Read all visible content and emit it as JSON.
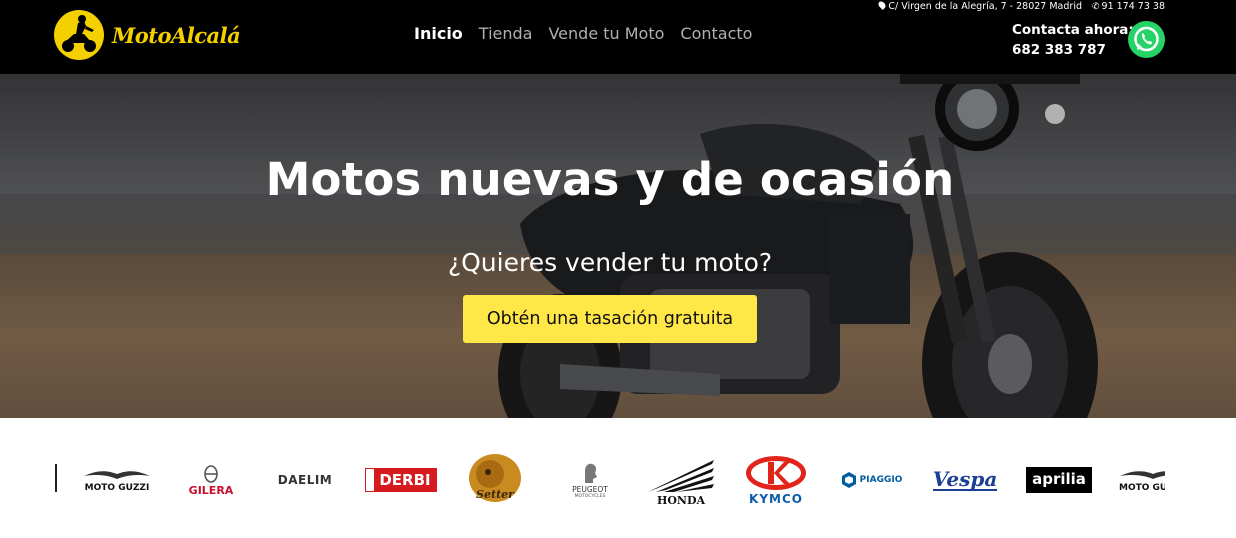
{
  "header": {
    "logo_text": "MotoAlcalá",
    "nav": [
      {
        "label": "Inicio",
        "active": true
      },
      {
        "label": "Tienda",
        "active": false
      },
      {
        "label": "Vende tu Moto",
        "active": false
      },
      {
        "label": "Contacto",
        "active": false
      }
    ],
    "address": "C/ Virgen de la Alegría, 7 - 28027 Madrid",
    "landline": "91 174 73 38",
    "contact_label": "Contacta ahora:",
    "contact_phone": "682 383 787",
    "icons": {
      "address": "map-pin-icon",
      "landline": "phone-icon",
      "whatsapp": "whatsapp-icon"
    }
  },
  "hero": {
    "title": "Motos nuevas y de ocasión",
    "subtitle": "¿Quieres vender tu moto?",
    "cta_label": "Obtén una tasación gratuita",
    "colors": {
      "cta": "#ffe747",
      "brand_yellow": "#f5d000"
    }
  },
  "brands": [
    {
      "name": "MOTO GUZZI"
    },
    {
      "name": "GILERA"
    },
    {
      "name": "DAELIM"
    },
    {
      "name": "DERBI"
    },
    {
      "name": "Setter"
    },
    {
      "name": "PEUGEOT",
      "sub": "MOTOCYCLES"
    },
    {
      "name": "HONDA"
    },
    {
      "name": "KYMCO"
    },
    {
      "name": "PIAGGIO"
    },
    {
      "name": "Vespa"
    },
    {
      "name": "aprilia"
    },
    {
      "name": "MOTO GU"
    }
  ]
}
